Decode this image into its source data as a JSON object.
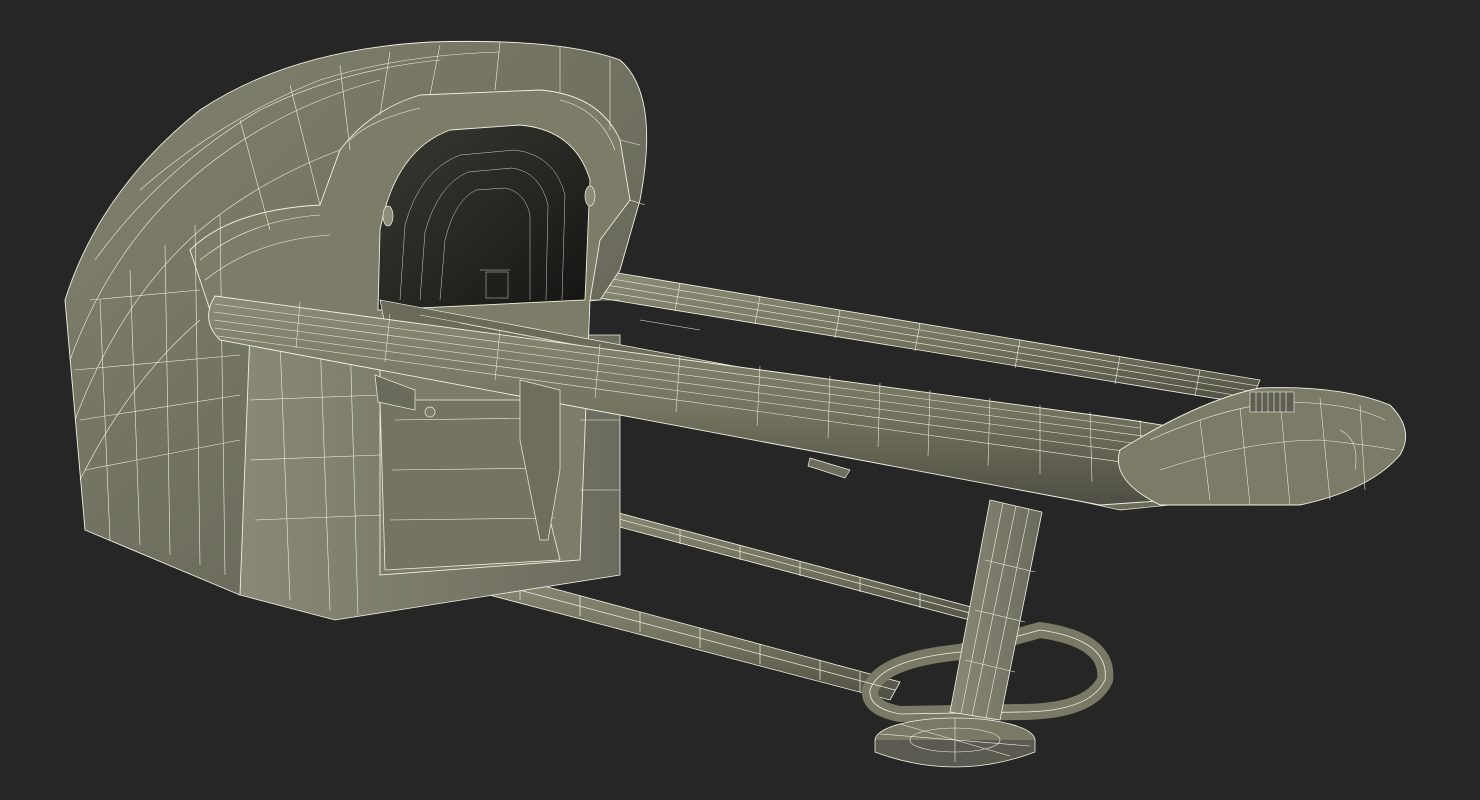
{
  "scene": {
    "subject": "wireframe-scanner-model",
    "background_color": "#262626",
    "surface_color": "#7b7a6c",
    "surface_shadow_color": "#4f4f45",
    "interior_color": "#1c1c1a",
    "wire_color": "#f0f0e2"
  }
}
